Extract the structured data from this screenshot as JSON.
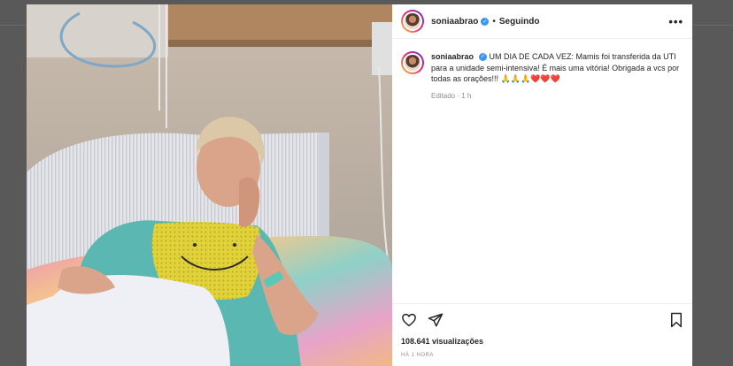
{
  "post": {
    "username": "soniaabrao",
    "follow_label": "Seguindo",
    "separator": "•",
    "more_label": "•••",
    "caption": "UM DIA DE CADA VEZ: Mamis foi transferida da UTI para a unidade semi-intensiva! É mais uma vitória! Obrigada a vcs por todas as orações!!! 🙏🙏🙏",
    "hearts": "❤️❤️❤️",
    "edited": "Editado · 1 h",
    "views": "108.641 visualizações",
    "time_ago": "HÁ 1 HORA"
  },
  "icons": {
    "like": "heart-icon",
    "share": "paper-plane-icon",
    "save": "bookmark-icon",
    "verified": "verified-badge-icon"
  },
  "colors": {
    "accent": "#3897f0",
    "heart": "#ed4956",
    "text": "#262626",
    "muted": "#8e8e8e"
  }
}
